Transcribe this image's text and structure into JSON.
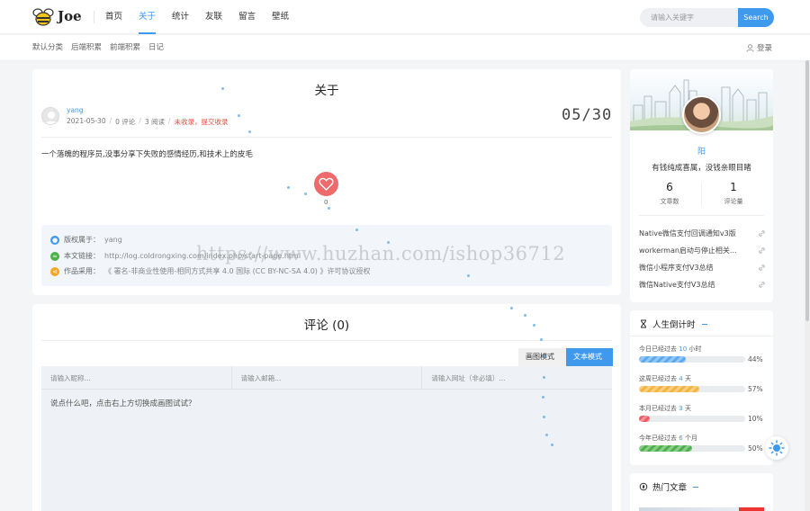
{
  "brand": {
    "name": "Joe"
  },
  "nav": {
    "items": [
      "首页",
      "关于",
      "统计",
      "友联",
      "留言",
      "壁纸"
    ],
    "active": "关于"
  },
  "search": {
    "placeholder": "请输入关键字",
    "button": "Search"
  },
  "subnav": {
    "items": [
      "默认分类",
      "后端积累",
      "前端积累",
      "日记"
    ]
  },
  "login": {
    "label": "登录"
  },
  "post": {
    "title": "关于",
    "author": "yang",
    "date": "2021-05-30",
    "comments": "0 评论",
    "views": "3 阅读",
    "status": "未收录，提交收录",
    "date_big": "05/30",
    "content": "一个落魄的程序员,没事分享下失败的感情经历,和技术上的皮毛",
    "likes": "0",
    "copyright": {
      "owner_label": "版权属于：",
      "owner": "yang",
      "link_label": "本文链接：",
      "link": "http://log.coldrongxing.com/index.php/start-page.html",
      "license_label": "作品采用：",
      "license": "《 署名-非商业性使用-相同方式共享 4.0 国际 (CC BY-NC-SA 4.0) 》许可协议授权"
    }
  },
  "comment": {
    "title": "评论 (0)",
    "mode_image": "画图模式",
    "mode_text": "文本模式",
    "name_placeholder": "请输入昵称...",
    "email_placeholder": "请输入邮箱...",
    "url_placeholder": "请输入网址（非必填）...",
    "text_placeholder": "说点什么吧，点击右上方切换成画图试试？"
  },
  "profile": {
    "name": "阳",
    "motto": "有钱纯成喜属，没钱亲眼目睹",
    "posts_count": "6",
    "posts_label": "文章数",
    "comments_count": "1",
    "comments_label": "评论量",
    "links": [
      "Native微信支付回调通知v3版",
      "workerman启动与停止相关...",
      "微信小程序支付V3总结",
      "微信Native支付V3总结"
    ]
  },
  "timer": {
    "title": "人生倒计时",
    "rows": [
      {
        "prefix": "今日已经过去",
        "num": "10",
        "unit": "小时",
        "pct": "44%",
        "value": 0.44,
        "color": "#5aa9f0"
      },
      {
        "prefix": "这周已经过去",
        "num": "4",
        "unit": "天",
        "pct": "57%",
        "value": 0.57,
        "color": "#f5b33d"
      },
      {
        "prefix": "本月已经过去",
        "num": "3",
        "unit": "天",
        "pct": "10%",
        "value": 0.1,
        "color": "#ef5861"
      },
      {
        "prefix": "今年已经过去",
        "num": "6",
        "unit": "个月",
        "pct": "50%",
        "value": 0.5,
        "color": "#4cb04b"
      }
    ]
  },
  "hot": {
    "title": "热门文章"
  },
  "watermark": "https://www.huzhan.com/ishop36712",
  "colors": {
    "accent": "#3f9aed",
    "like": "#ef6a6a",
    "warn": "#e74c3c"
  },
  "icons": {
    "like": "heart-icon",
    "login": "user-icon",
    "timer": "hourglass-icon",
    "hot": "fire-icon",
    "theme": "sun-icon"
  }
}
